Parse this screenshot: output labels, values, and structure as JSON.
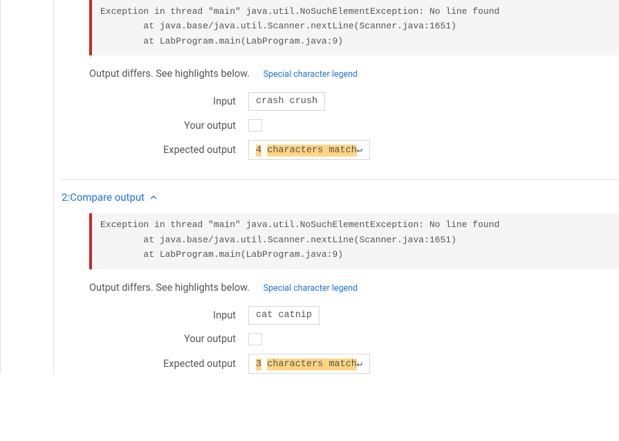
{
  "test1": {
    "error": "Exception in thread \"main\" java.util.NoSuchElementException: No line found\n        at java.base/java.util.Scanner.nextLine(Scanner.java:1651)\n        at LabProgram.main(LabProgram.java:9)",
    "diff_msg": "Output differs. See highlights below.",
    "legend": "Special character legend",
    "labels": {
      "input": "Input",
      "your": "Your output",
      "expected": "Expected output"
    },
    "input": "crash crush",
    "your_output": "",
    "expected": {
      "num": "4",
      "rest": "characters match",
      "nl": "↵"
    }
  },
  "test2": {
    "header": "2:Compare output",
    "error": "Exception in thread \"main\" java.util.NoSuchElementException: No line found\n        at java.base/java.util.Scanner.nextLine(Scanner.java:1651)\n        at LabProgram.main(LabProgram.java:9)",
    "diff_msg": "Output differs. See highlights below.",
    "legend": "Special character legend",
    "labels": {
      "input": "Input",
      "your": "Your output",
      "expected": "Expected output"
    },
    "input": "cat catnip",
    "your_output": "",
    "expected": {
      "num": "3",
      "rest": "characters match",
      "nl": "↵"
    }
  }
}
